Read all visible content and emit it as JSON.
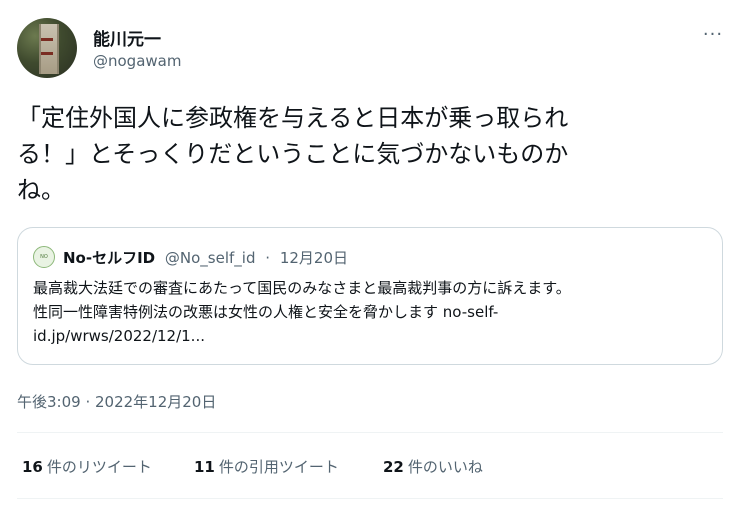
{
  "author": {
    "display_name": "能川元一",
    "handle": "@nogawam",
    "avatar_icon": "stone-monument-avatar"
  },
  "tweet_text": "「定住外国人に参政権を与えると日本が乗っ取られ\nる！」とそっくりだということに気づかないものか\nね。",
  "more_icon": "···",
  "quoted": {
    "avatar_text": "NO SELF ID",
    "display_name": "No-セルフID",
    "handle": "@No_self_id",
    "separator": "·",
    "date": "12月20日",
    "text": "最高裁大法廷での審査にあたって国民のみなさまと最高裁判事の方に訴えます。\n性同一性障害特例法の改悪は女性の人権と安全を脅かします no-self-\nid.jp/wrws/2022/12/1..."
  },
  "timestamp": "午後3:09 · 2022年12月20日",
  "stats": [
    {
      "count": "16",
      "label": "件のリツイート"
    },
    {
      "count": "11",
      "label": "件の引用ツイート"
    },
    {
      "count": "22",
      "label": "件のいいね"
    }
  ],
  "colors": {
    "text": "#0f1419",
    "secondary": "#536471",
    "border": "#cfd9de"
  }
}
